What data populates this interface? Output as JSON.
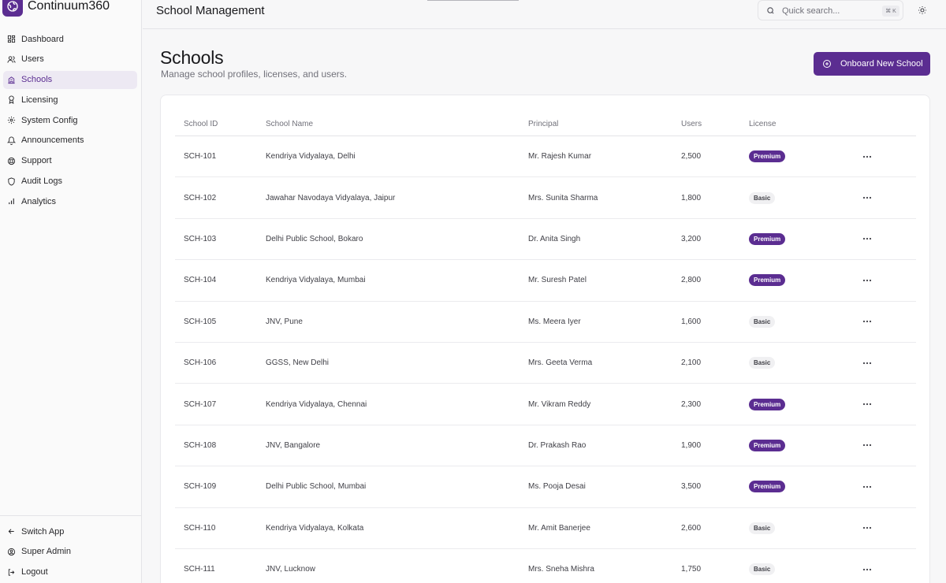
{
  "brand": {
    "name": "Continuum360",
    "accent": "#5b2d91"
  },
  "sidebar": {
    "items": [
      {
        "label": "Dashboard",
        "icon": "dashboard-icon",
        "active": false
      },
      {
        "label": "Users",
        "icon": "users-icon",
        "active": false
      },
      {
        "label": "Schools",
        "icon": "school-icon",
        "active": true
      },
      {
        "label": "Licensing",
        "icon": "award-icon",
        "active": false
      },
      {
        "label": "System Config",
        "icon": "gear-icon",
        "active": false
      },
      {
        "label": "Announcements",
        "icon": "bell-icon",
        "active": false
      },
      {
        "label": "Support",
        "icon": "lifebuoy-icon",
        "active": false
      },
      {
        "label": "Audit Logs",
        "icon": "shield-icon",
        "active": false
      },
      {
        "label": "Analytics",
        "icon": "bar-chart-icon",
        "active": false
      }
    ],
    "bottom": [
      {
        "label": "Switch App",
        "icon": "arrow-left-icon"
      },
      {
        "label": "Super Admin",
        "icon": "user-circle-icon"
      },
      {
        "label": "Logout",
        "icon": "logout-icon"
      }
    ]
  },
  "header": {
    "title": "School Management",
    "search": {
      "placeholder": "Quick search...",
      "shortcut": "⌘ K"
    }
  },
  "main": {
    "title": "Schools",
    "subtitle": "Manage school profiles, licenses, and users.",
    "primary_button": "Onboard New School"
  },
  "table": {
    "columns": [
      "School ID",
      "School Name",
      "Principal",
      "Users",
      "License"
    ],
    "rows": [
      {
        "id": "SCH-101",
        "name": "Kendriya Vidyalaya, Delhi",
        "principal": "Mr. Rajesh Kumar",
        "users": "2,500",
        "license": "Premium"
      },
      {
        "id": "SCH-102",
        "name": "Jawahar Navodaya Vidyalaya, Jaipur",
        "principal": "Mrs. Sunita Sharma",
        "users": "1,800",
        "license": "Basic"
      },
      {
        "id": "SCH-103",
        "name": "Delhi Public School, Bokaro",
        "principal": "Dr. Anita Singh",
        "users": "3,200",
        "license": "Premium"
      },
      {
        "id": "SCH-104",
        "name": "Kendriya Vidyalaya, Mumbai",
        "principal": "Mr. Suresh Patel",
        "users": "2,800",
        "license": "Premium"
      },
      {
        "id": "SCH-105",
        "name": "JNV, Pune",
        "principal": "Ms. Meera Iyer",
        "users": "1,600",
        "license": "Basic"
      },
      {
        "id": "SCH-106",
        "name": "GGSS, New Delhi",
        "principal": "Mrs. Geeta Verma",
        "users": "2,100",
        "license": "Basic"
      },
      {
        "id": "SCH-107",
        "name": "Kendriya Vidyalaya, Chennai",
        "principal": "Mr. Vikram Reddy",
        "users": "2,300",
        "license": "Premium"
      },
      {
        "id": "SCH-108",
        "name": "JNV, Bangalore",
        "principal": "Dr. Prakash Rao",
        "users": "1,900",
        "license": "Premium"
      },
      {
        "id": "SCH-109",
        "name": "Delhi Public School, Mumbai",
        "principal": "Ms. Pooja Desai",
        "users": "3,500",
        "license": "Premium"
      },
      {
        "id": "SCH-110",
        "name": "Kendriya Vidyalaya, Kolkata",
        "principal": "Mr. Amit Banerjee",
        "users": "2,600",
        "license": "Basic"
      },
      {
        "id": "SCH-111",
        "name": "JNV, Lucknow",
        "principal": "Mrs. Sneha Mishra",
        "users": "1,750",
        "license": "Basic"
      }
    ]
  }
}
